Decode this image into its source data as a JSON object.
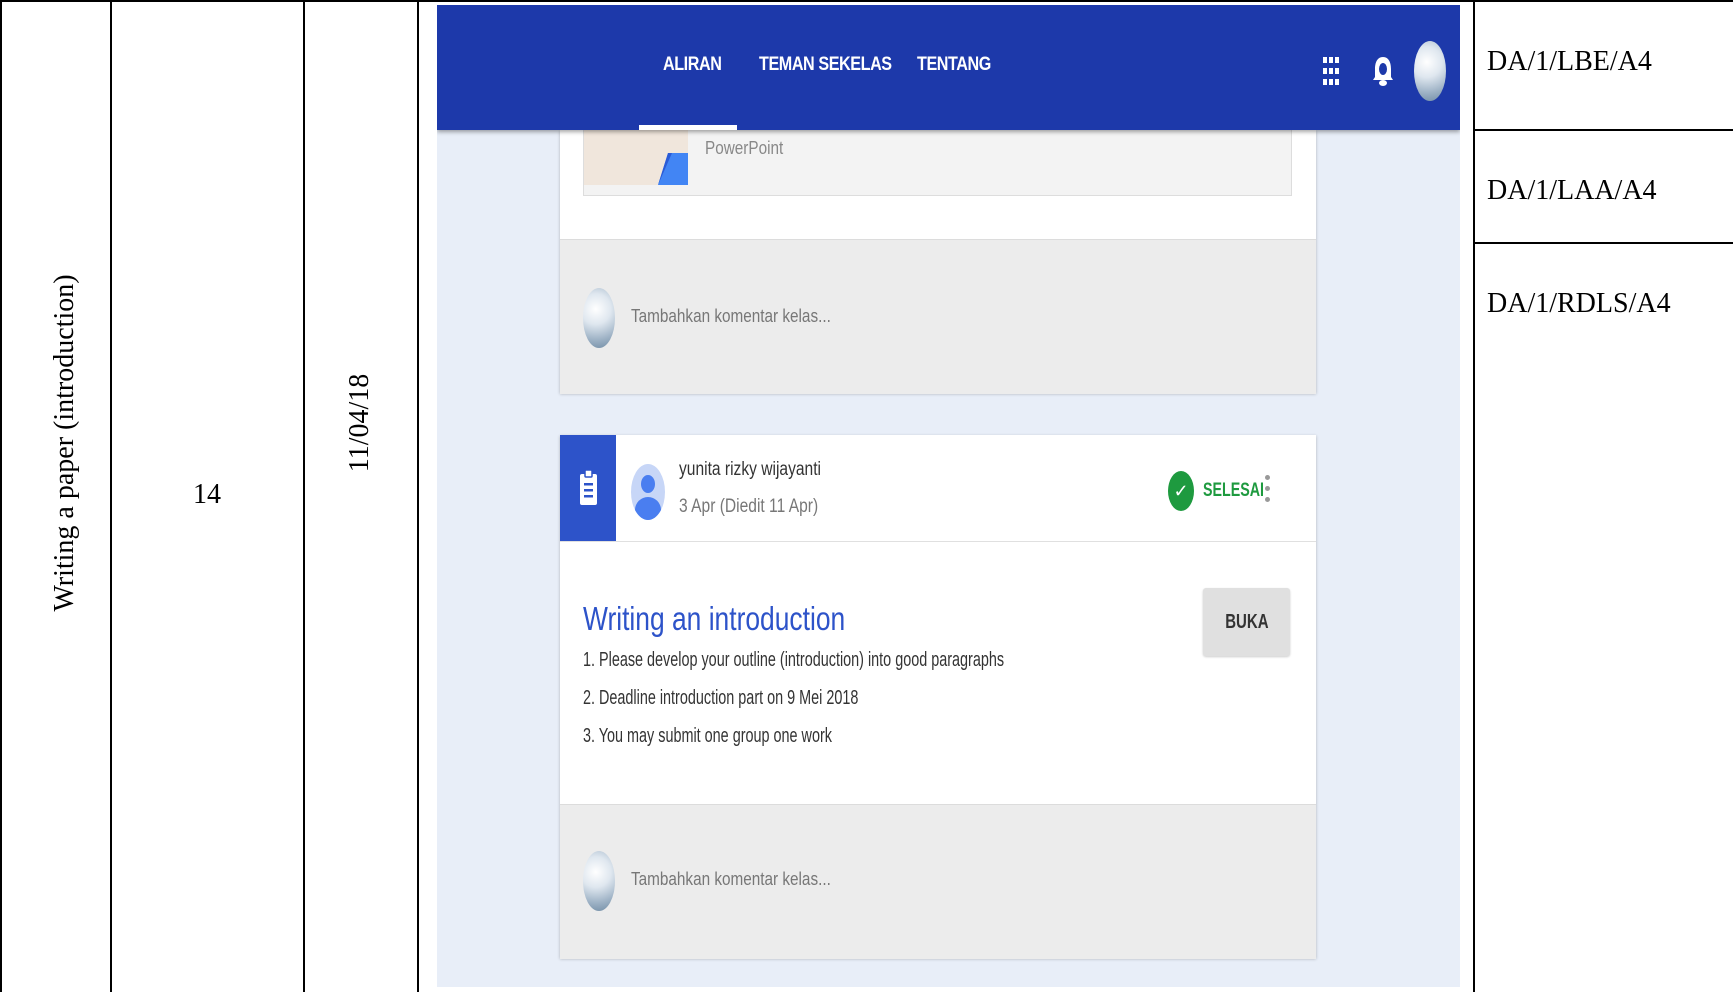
{
  "table": {
    "topic": "Writing a paper (introduction)",
    "meeting": "14",
    "date": "11/04/18",
    "codes": [
      "DA/1/LBE/A4",
      "DA/1/LAA/A4",
      "DA/1/RDLS/A4"
    ]
  },
  "classroom": {
    "tabs": [
      "ALIRAN",
      "TEMAN SEKELAS",
      "TENTANG"
    ],
    "active_tab": "ALIRAN",
    "header_icons": [
      "apps-grid-icon",
      "notifications-bell-icon",
      "profile-avatar"
    ],
    "attachment_type": "PowerPoint",
    "comment_placeholder": "Tambahkan komentar kelas...",
    "post": {
      "author": "yunita rizky wijayanti",
      "date": "3 Apr (Diedit 11 Apr)",
      "status": "SELESAI",
      "title": "Writing an introduction",
      "lines": [
        "1. Please develop your outline (introduction) into good paragraphs",
        "2. Deadline introduction part on 9 Mei 2018",
        "3. You may submit one group one work"
      ],
      "open_button": "BUKA"
    },
    "colors": {
      "header": "#1d39aa",
      "accent": "#2d53c9",
      "status": "#1e9a3f",
      "background": "#e8eef8"
    }
  }
}
